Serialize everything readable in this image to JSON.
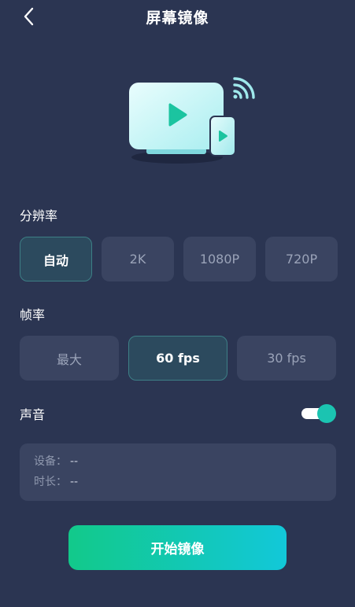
{
  "header": {
    "title": "屏幕镜像"
  },
  "resolution": {
    "label": "分辨率",
    "options": [
      "自动",
      "2K",
      "1080P",
      "720P"
    ],
    "selected": "自动"
  },
  "framerate": {
    "label": "帧率",
    "options": [
      "最大",
      "60 fps",
      "30 fps"
    ],
    "selected": "60 fps"
  },
  "sound": {
    "label": "声音",
    "enabled": true
  },
  "info": {
    "device_label": "设备：",
    "device_value": "--",
    "duration_label": "时长：",
    "duration_value": "--"
  },
  "start_button": {
    "label": "开始镜像"
  },
  "colors": {
    "background": "#2b3552",
    "accent": "#1bc4b1",
    "button_gradient_start": "#12c98a",
    "button_gradient_end": "#12c8d9"
  },
  "icons": {
    "back": "chevron-left-icon",
    "illustration": "screen-mirror-illustration"
  }
}
